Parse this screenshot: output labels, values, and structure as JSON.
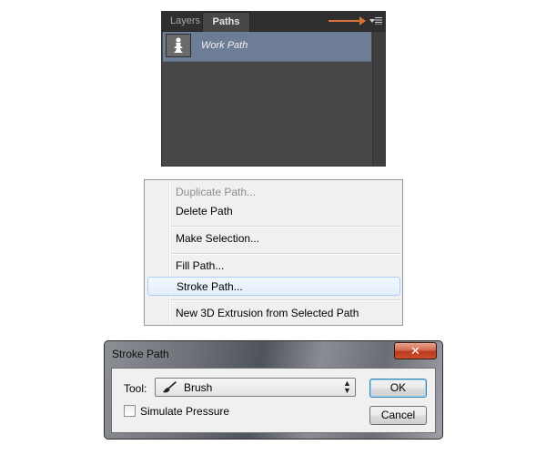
{
  "paths_panel": {
    "tabs": [
      {
        "label": "Layers",
        "active": false
      },
      {
        "label": "Paths",
        "active": true
      }
    ],
    "menu_icon": "panel-menu-icon",
    "arrow_color": "#d9713b",
    "paths": [
      {
        "name": "Work Path",
        "selected": true,
        "thumbnail_icon": "path-thumbnail-icon"
      }
    ]
  },
  "context_menu": {
    "items": [
      {
        "label": "Duplicate Path...",
        "enabled": false
      },
      {
        "label": "Delete Path",
        "enabled": true
      },
      {
        "label": "Make Selection...",
        "enabled": true
      },
      {
        "label": "Fill Path...",
        "enabled": true
      },
      {
        "label": "Stroke Path...",
        "enabled": true,
        "highlighted": true
      },
      {
        "label": "New 3D Extrusion from Selected Path",
        "enabled": true
      }
    ]
  },
  "stroke_dialog": {
    "title": "Stroke Path",
    "close_label": "✕",
    "tool_label": "Tool:",
    "tool_value": "Brush",
    "tool_icon": "brush-icon",
    "simulate_pressure_label": "Simulate Pressure",
    "simulate_pressure_checked": false,
    "ok_label": "OK",
    "cancel_label": "Cancel"
  }
}
